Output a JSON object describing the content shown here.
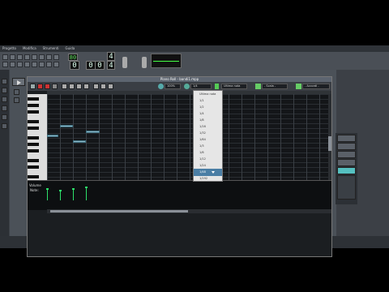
{
  "menubar": {
    "items": [
      "Progetto",
      "Modifica",
      "Strumenti",
      "Guida"
    ]
  },
  "toolbar": {
    "tempo": "80",
    "time_sig_num": "4",
    "time_sig_den": "4",
    "clock": [
      "0",
      "0",
      "0"
    ]
  },
  "piano_roll": {
    "title": "Piano Roll - bandi1.mpp",
    "zoom": "100%",
    "quantize": "1/4",
    "note_length": "Ultima nota",
    "scale": "- Scala -",
    "chord": "- Accordi -",
    "velocity_label": "Volume",
    "velocity_sub": "Note:"
  },
  "dropdown": {
    "items": [
      "Ultima nota",
      "1/1",
      "1/2",
      "1/4",
      "1/8",
      "1/16",
      "1/32",
      "1/64",
      "1/3",
      "1/6",
      "1/12",
      "1/24",
      "1/48",
      "1/192"
    ],
    "selected_index": 12
  },
  "taskbar": {
    "items": [
      "Bbmmm 5...",
      "Corso Strumentazione"
    ]
  },
  "colors": {
    "accent": "#4a7ea5",
    "note": "#8fb8c8",
    "velocity": "#2de06a",
    "slot_highlight": "#55c0c0"
  }
}
